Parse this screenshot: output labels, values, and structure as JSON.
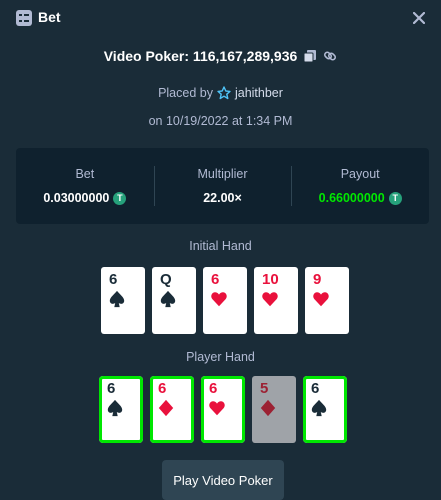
{
  "header": {
    "title": "Bet",
    "icon": "bet-list-icon",
    "close_icon": "close-icon"
  },
  "game": {
    "label": "Video Poker: 116,167,289,936",
    "copy_icon": "copy-icon",
    "link_icon": "link-icon"
  },
  "placed": {
    "prefix": "Placed by",
    "user": "jahithber",
    "user_icon": "star-badge-icon"
  },
  "date": "on 10/19/2022 at 1:34 PM",
  "stats": {
    "bet_label": "Bet",
    "bet_value": "0.03000000",
    "multiplier_label": "Multiplier",
    "multiplier_value": "22.00×",
    "payout_label": "Payout",
    "payout_value": "0.66000000",
    "currency_symbol": "T",
    "payout_color": "#00e701"
  },
  "initial_hand": {
    "label": "Initial Hand",
    "cards": [
      {
        "rank": "6",
        "suit": "spades"
      },
      {
        "rank": "Q",
        "suit": "spades"
      },
      {
        "rank": "6",
        "suit": "hearts"
      },
      {
        "rank": "10",
        "suit": "hearts"
      },
      {
        "rank": "9",
        "suit": "hearts"
      }
    ]
  },
  "player_hand": {
    "label": "Player Hand",
    "cards": [
      {
        "rank": "6",
        "suit": "spades",
        "held": true
      },
      {
        "rank": "6",
        "suit": "diamonds",
        "held": true
      },
      {
        "rank": "6",
        "suit": "hearts",
        "held": true
      },
      {
        "rank": "5",
        "suit": "diamonds",
        "held": false
      },
      {
        "rank": "6",
        "suit": "spades",
        "held": true
      }
    ]
  },
  "play_button": "Play Video Poker"
}
